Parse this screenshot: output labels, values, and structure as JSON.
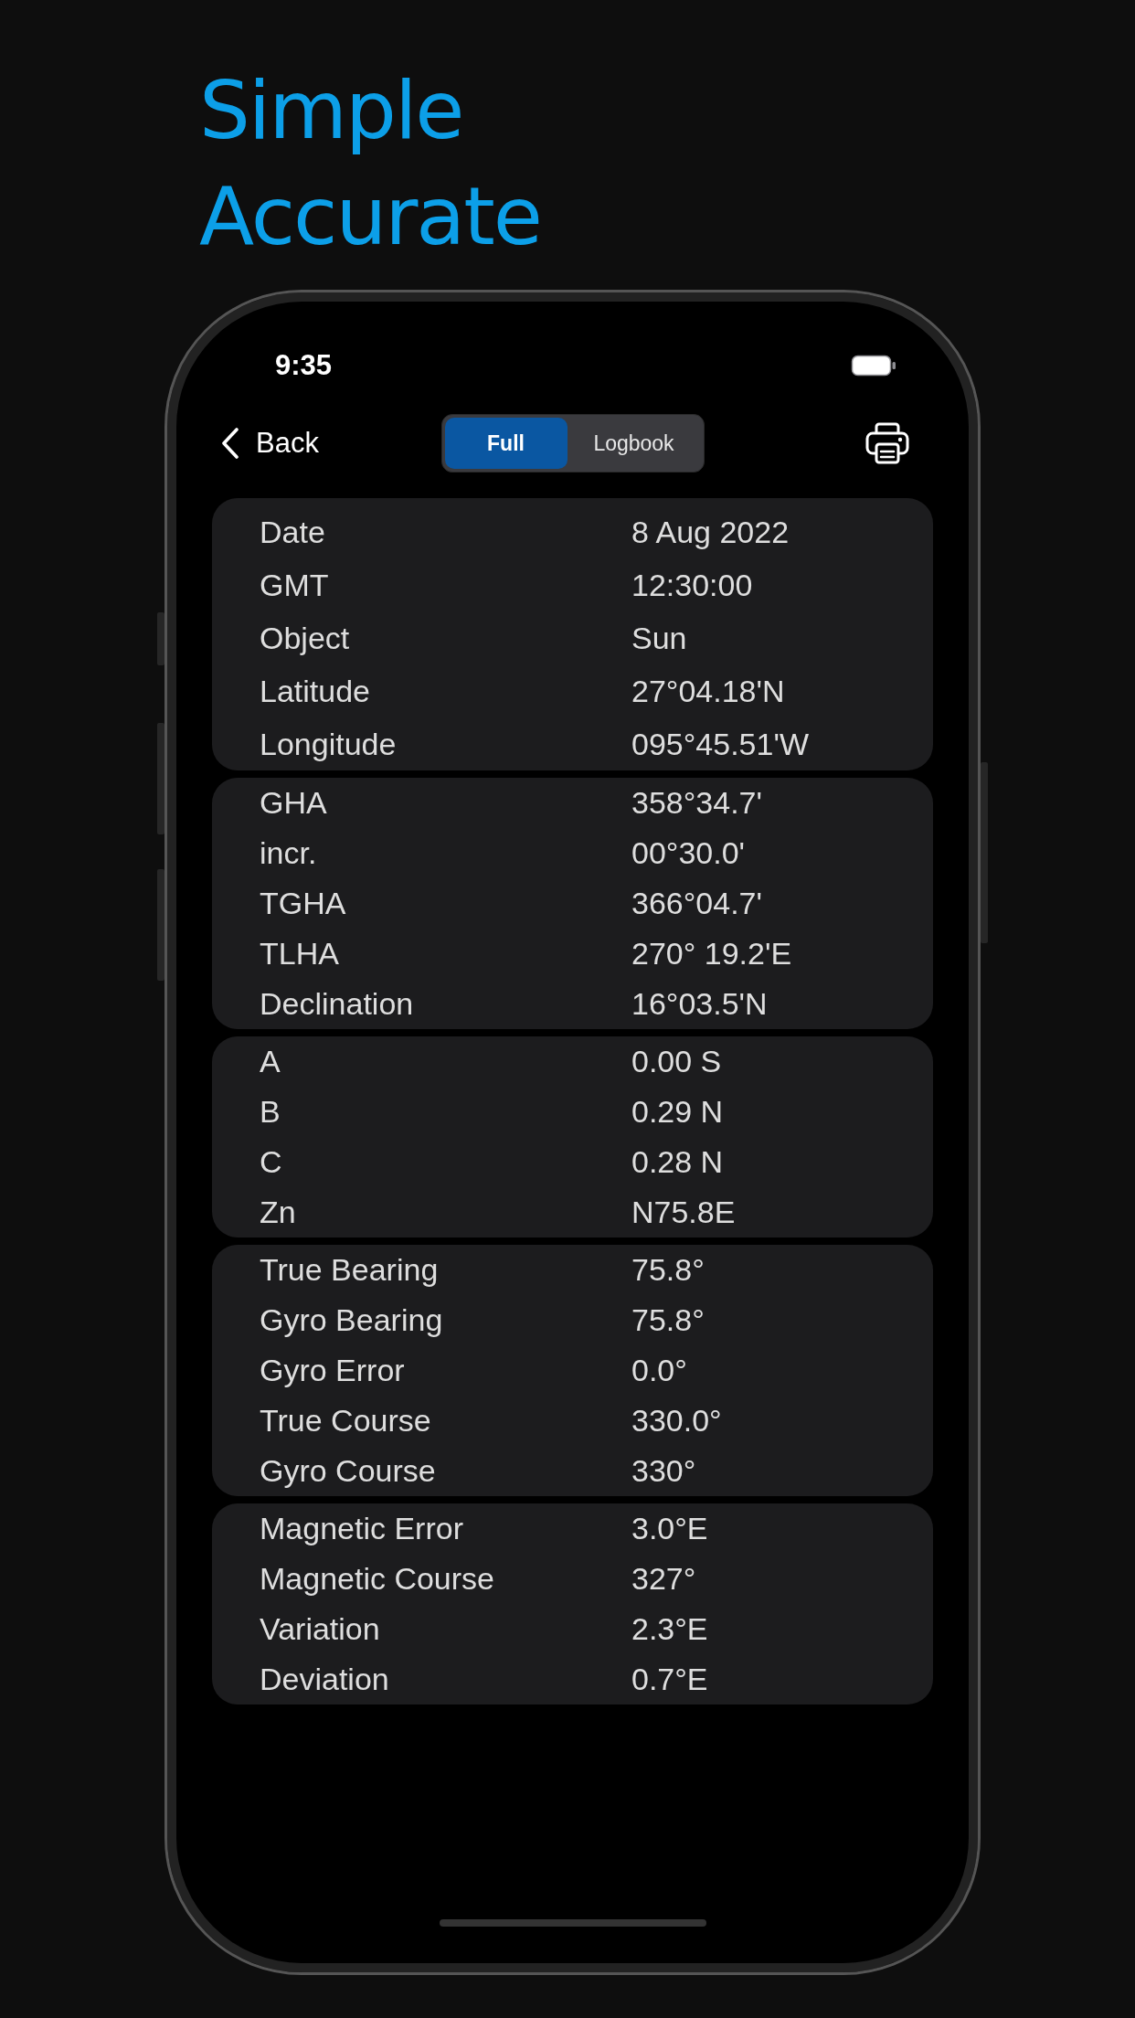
{
  "headline": [
    "Simple",
    "Accurate"
  ],
  "status_bar": {
    "time": "9:35"
  },
  "nav_bar": {
    "back": "Back",
    "segments": [
      {
        "label": "Full",
        "selected": true
      },
      {
        "label": "Logbook",
        "selected": false
      }
    ]
  },
  "sections": [
    {
      "rows": [
        {
          "label": "Date",
          "value": "8 Aug 2022"
        },
        {
          "label": "GMT",
          "value": "12:30:00"
        },
        {
          "label": "Object",
          "value": "Sun"
        },
        {
          "label": "Latitude",
          "value": "27°04.18'N"
        },
        {
          "label": "Longitude",
          "value": "095°45.51'W"
        }
      ]
    },
    {
      "rows": [
        {
          "label": "GHA",
          "value": "358°34.7'"
        },
        {
          "label": "incr.",
          "value": "00°30.0'"
        },
        {
          "label": "TGHA",
          "value": "366°04.7'"
        },
        {
          "label": "TLHA",
          "value": "270° 19.2'E"
        },
        {
          "label": "Declination",
          "value": "16°03.5'N"
        }
      ]
    },
    {
      "rows": [
        {
          "label": "A",
          "value": "0.00 S"
        },
        {
          "label": "B",
          "value": "0.29 N"
        },
        {
          "label": "C",
          "value": "0.28 N"
        },
        {
          "label": "Zn",
          "value": "N75.8E"
        }
      ]
    },
    {
      "rows": [
        {
          "label": "True Bearing",
          "value": "75.8°"
        },
        {
          "label": "Gyro Bearing",
          "value": "75.8°"
        },
        {
          "label": "Gyro Error",
          "value": "0.0°"
        },
        {
          "label": "True Course",
          "value": "330.0°"
        },
        {
          "label": "Gyro Course",
          "value": "330°"
        }
      ]
    },
    {
      "rows": [
        {
          "label": "Magnetic Error",
          "value": "3.0°E"
        },
        {
          "label": "Magnetic Course",
          "value": "327°"
        },
        {
          "label": "Variation",
          "value": "2.3°E"
        },
        {
          "label": "Deviation",
          "value": "0.7°E"
        }
      ]
    }
  ]
}
